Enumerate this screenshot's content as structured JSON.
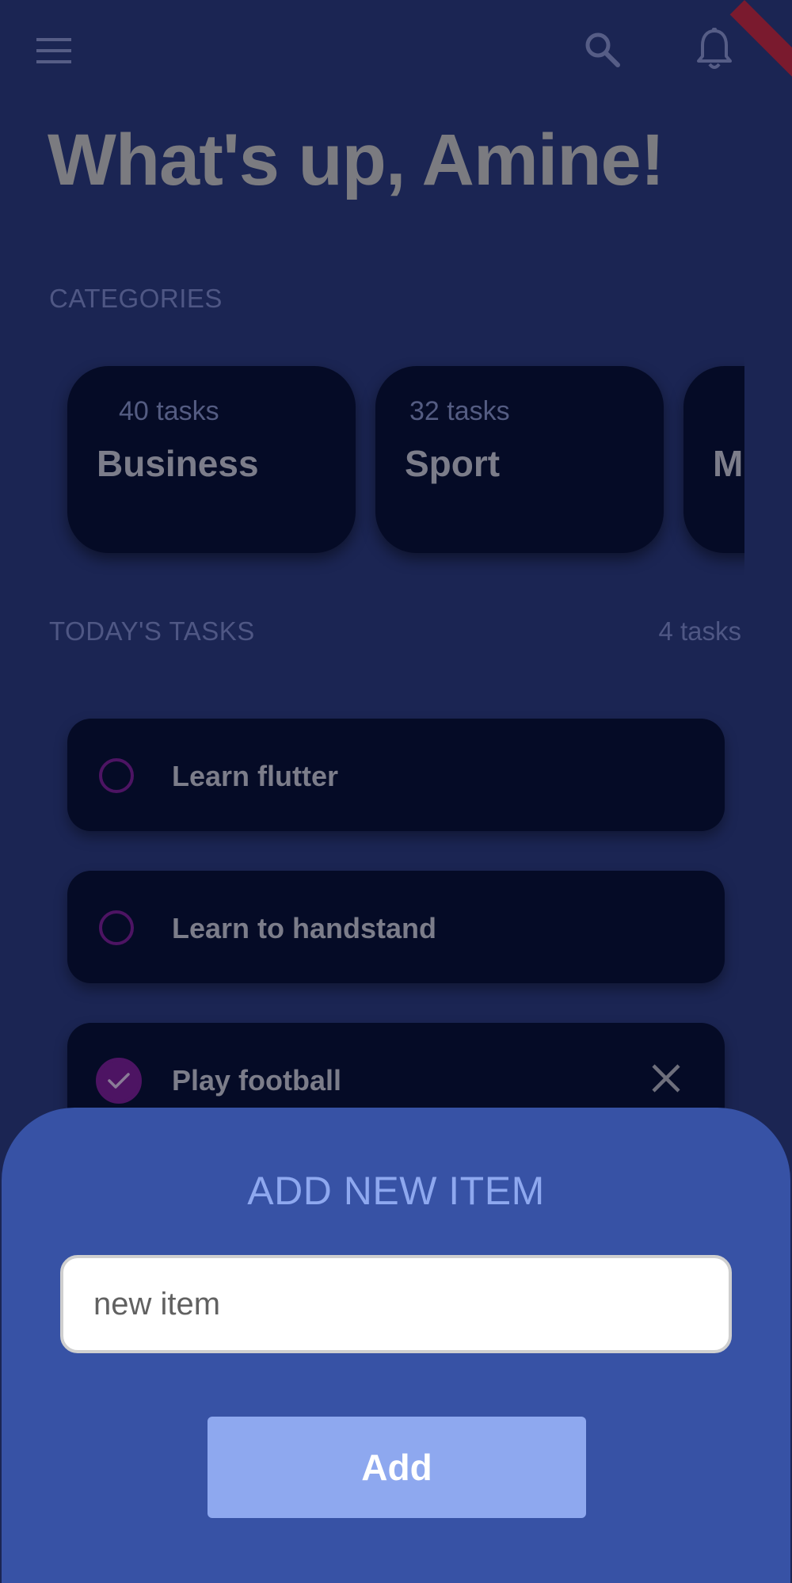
{
  "header": {
    "icons": [
      "menu-icon",
      "search-icon",
      "bell-icon"
    ],
    "greeting": "What's up, Amine!"
  },
  "categories": {
    "label": "CATEGORIES",
    "items": [
      {
        "count": "40 tasks",
        "name": "Business"
      },
      {
        "count": "32 tasks",
        "name": "Sport"
      },
      {
        "count": "",
        "name": "M"
      }
    ]
  },
  "today": {
    "label": "TODAY'S TASKS",
    "count": "4 tasks",
    "tasks": [
      {
        "label": "Learn flutter",
        "done": false
      },
      {
        "label": "Learn to handstand",
        "done": false
      },
      {
        "label": "Play football",
        "done": true
      }
    ]
  },
  "sheet": {
    "title": "ADD NEW ITEM",
    "input_placeholder": "new item",
    "input_value": "",
    "button_label": "Add"
  },
  "colors": {
    "background": "#1b2553",
    "card": "#050b26",
    "accent_purple": "#4d1463",
    "sheet": "#3752a5",
    "button": "#8ea8ef"
  }
}
